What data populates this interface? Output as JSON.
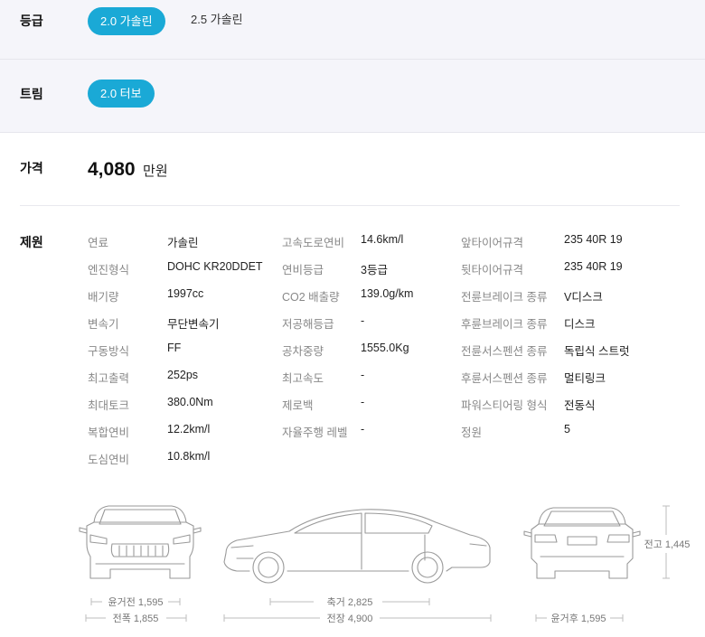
{
  "grade": {
    "label": "등급",
    "options": [
      {
        "label": "2.0 가솔린",
        "active": true
      },
      {
        "label": "2.5 가솔린",
        "active": false
      }
    ]
  },
  "trim": {
    "label": "트림",
    "options": [
      {
        "label": "2.0 터보",
        "active": true
      }
    ]
  },
  "price": {
    "label": "가격",
    "value": "4,080",
    "unit": "만원"
  },
  "specs": {
    "label": "제원",
    "col1": [
      {
        "k": "연료",
        "v": "가솔린"
      },
      {
        "k": "엔진형식",
        "v": "DOHC KR20DDET"
      },
      {
        "k": "배기량",
        "v": "1997cc"
      },
      {
        "k": "변속기",
        "v": "무단변속기"
      },
      {
        "k": "구동방식",
        "v": "FF"
      },
      {
        "k": "최고출력",
        "v": "252ps"
      },
      {
        "k": "최대토크",
        "v": "380.0Nm"
      },
      {
        "k": "복합연비",
        "v": "12.2km/l"
      },
      {
        "k": "도심연비",
        "v": "10.8km/l"
      }
    ],
    "col2": [
      {
        "k": "고속도로연비",
        "v": "14.6km/l"
      },
      {
        "k": "연비등급",
        "v": "3등급"
      },
      {
        "k": "CO2 배출량",
        "v": "139.0g/km"
      },
      {
        "k": "저공해등급",
        "v": "-"
      },
      {
        "k": "공차중량",
        "v": "1555.0Kg"
      },
      {
        "k": "최고속도",
        "v": "-"
      },
      {
        "k": "제로백",
        "v": "-"
      },
      {
        "k": "자율주행 레벨",
        "v": "-"
      }
    ],
    "col3": [
      {
        "k": "앞타이어규격",
        "v": "235 40R 19"
      },
      {
        "k": "뒷타이어규격",
        "v": "235 40R 19"
      },
      {
        "k": "전륜브레이크 종류",
        "v": "V디스크"
      },
      {
        "k": "후륜브레이크 종류",
        "v": "디스크"
      },
      {
        "k": "전륜서스펜션 종류",
        "v": "독립식 스트럿"
      },
      {
        "k": "후륜서스펜션 종류",
        "v": "멀티링크"
      },
      {
        "k": "파워스티어링 형식",
        "v": "전동식"
      },
      {
        "k": "정원",
        "v": "5"
      }
    ]
  },
  "dimensions": {
    "front_track": "윤거전 1,595",
    "width": "전폭 1,855",
    "wheelbase": "축거 2,825",
    "length": "전장 4,900",
    "rear_track": "윤거후 1,595",
    "height": "전고 1,445"
  }
}
